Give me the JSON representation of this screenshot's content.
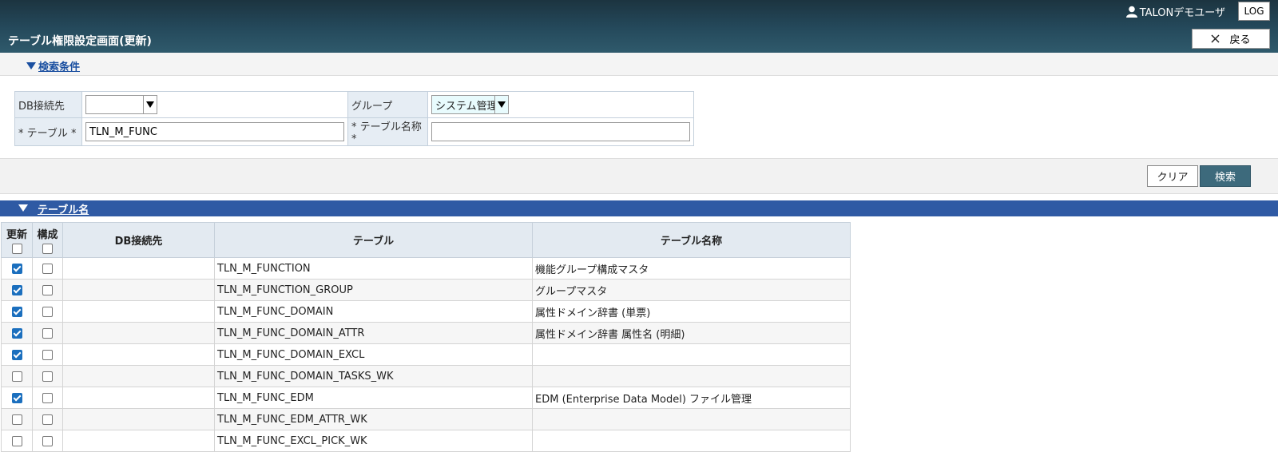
{
  "header": {
    "user_name": "TALONデモユーザ",
    "log_button": "LOG",
    "page_title": "テーブル権限設定画面(更新)",
    "back_button": "戻る"
  },
  "search": {
    "toggle_label": "検索条件",
    "db_label": "DB接続先",
    "db_value": "",
    "group_label": "グループ",
    "group_value": "システム管理",
    "table_label": "* テーブル *",
    "table_value": "TLN_M_FUNC",
    "table_name_label": "* テーブル名称 *",
    "table_name_value": "",
    "clear_button": "クリア",
    "search_button": "検索"
  },
  "results": {
    "section_label": "テーブル名",
    "columns": {
      "update": "更新",
      "config": "構成",
      "db": "DB接続先",
      "table": "テーブル",
      "table_name": "テーブル名称"
    },
    "rows": [
      {
        "update": true,
        "config": false,
        "db": "",
        "table": "TLN_M_FUNCTION",
        "name": "機能グループ構成マスタ"
      },
      {
        "update": true,
        "config": false,
        "db": "",
        "table": "TLN_M_FUNCTION_GROUP",
        "name": "グループマスタ"
      },
      {
        "update": true,
        "config": false,
        "db": "",
        "table": "TLN_M_FUNC_DOMAIN",
        "name": "属性ドメイン辞書 (単票)"
      },
      {
        "update": true,
        "config": false,
        "db": "",
        "table": "TLN_M_FUNC_DOMAIN_ATTR",
        "name": "属性ドメイン辞書 属性名 (明細)"
      },
      {
        "update": true,
        "config": false,
        "db": "",
        "table": "TLN_M_FUNC_DOMAIN_EXCL",
        "name": ""
      },
      {
        "update": false,
        "config": false,
        "db": "",
        "table": "TLN_M_FUNC_DOMAIN_TASKS_WK",
        "name": ""
      },
      {
        "update": true,
        "config": false,
        "db": "",
        "table": "TLN_M_FUNC_EDM",
        "name": "EDM (Enterprise Data Model) ファイル管理"
      },
      {
        "update": false,
        "config": false,
        "db": "",
        "table": "TLN_M_FUNC_EDM_ATTR_WK",
        "name": ""
      },
      {
        "update": false,
        "config": false,
        "db": "",
        "table": "TLN_M_FUNC_EXCL_PICK_WK",
        "name": ""
      }
    ]
  },
  "colors": {
    "header_dark": "#1c3440",
    "section_blue": "#2f5aa4",
    "search_button": "#3d6a7c",
    "checkbox_checked": "#1b6fbe"
  }
}
